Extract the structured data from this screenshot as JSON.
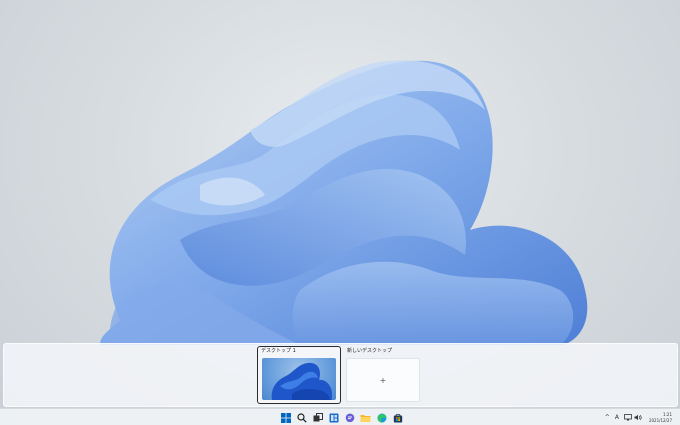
{
  "taskview": {
    "desktops": [
      {
        "label": "デスクトップ 1"
      },
      {
        "label": "新しいデスクトップ"
      }
    ],
    "add_symbol": "+"
  },
  "taskbar": {
    "apps": [
      {
        "name": "start",
        "icon": "windows-logo-icon"
      },
      {
        "name": "search",
        "icon": "search-icon"
      },
      {
        "name": "task-view",
        "icon": "task-view-icon"
      },
      {
        "name": "widgets",
        "icon": "widgets-icon"
      },
      {
        "name": "chat",
        "icon": "chat-icon"
      },
      {
        "name": "file-explorer",
        "icon": "folder-icon"
      },
      {
        "name": "edge",
        "icon": "edge-icon"
      },
      {
        "name": "store",
        "icon": "store-icon"
      }
    ],
    "tray": {
      "chevron": "^",
      "ime": "A",
      "clock_time": "1:21",
      "clock_date": "2021/12/27"
    }
  },
  "colors": {
    "accent": "#0067c0",
    "bloom": "#5b8fe0"
  }
}
